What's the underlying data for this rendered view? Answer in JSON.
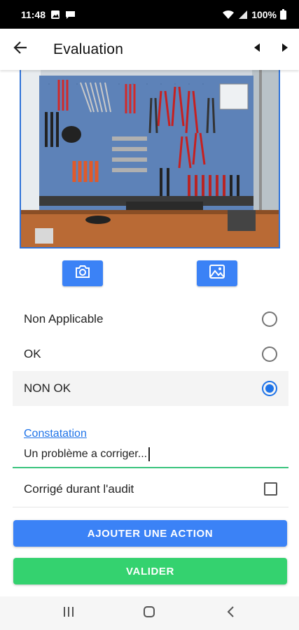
{
  "status_bar": {
    "time": "11:48",
    "battery": "100%",
    "left_icons": [
      "image-icon",
      "message-icon"
    ],
    "right_icons": [
      "wifi-icon",
      "signal-icon",
      "battery-icon"
    ]
  },
  "app_bar": {
    "title": "Evaluation",
    "back_icon": "arrow-back-icon",
    "prev_icon": "triangle-left-icon",
    "next_icon": "triangle-right-icon"
  },
  "photo": {
    "subject": "tool-wall-pegboard-image"
  },
  "photo_buttons": {
    "camera_icon": "camera-icon",
    "gallery_icon": "gallery-icon"
  },
  "options": [
    {
      "label": "Non Applicable",
      "selected": false
    },
    {
      "label": "OK",
      "selected": false
    },
    {
      "label": "NON OK",
      "selected": true
    }
  ],
  "constatation": {
    "label": "Constatation",
    "value": "Un problème a corriger..."
  },
  "corrected_during_audit": {
    "label": "Corrigé durant l'audit",
    "checked": false
  },
  "buttons": {
    "add_action": "AJOUTER UNE ACTION",
    "validate": "VALIDER"
  },
  "nav_bar": {
    "icons": [
      "recent-apps-icon",
      "home-icon",
      "back-icon"
    ]
  },
  "colors": {
    "primary": "#3b82f6",
    "success": "#34d26f",
    "radio_selected": "#1e73e8",
    "underline": "#3ac47d"
  }
}
